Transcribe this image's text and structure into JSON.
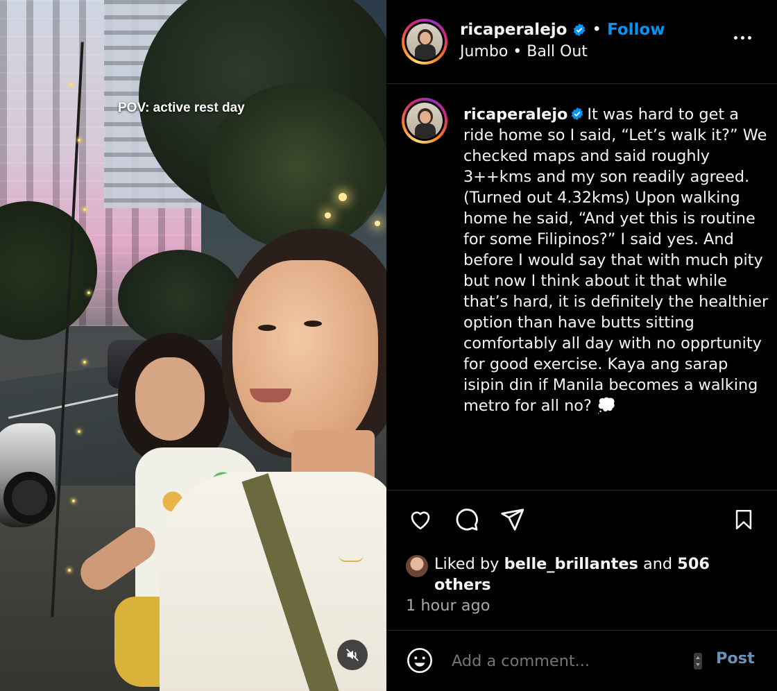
{
  "media": {
    "overlay_text": "POV: active rest day",
    "mute_icon": "muted-speaker-icon"
  },
  "header": {
    "username": "ricaperalejo",
    "separator": "•",
    "follow_label": "Follow",
    "audio": "Jumbo • Ball Out",
    "more_icon": "more-horizontal-icon"
  },
  "caption": {
    "username": "ricaperalejo",
    "text": "It was hard to get a ride home so I said, “Let’s walk it?” We checked maps and said roughly 3++kms and my son readily agreed. (Turned out 4.32kms) Upon walking home he said, “And yet this is routine for some Filipinos?” I said yes. And before I would say that with much pity but now I think about it that while that’s hard, it is definitely the healthier option than have butts sitting comfortably all day with no opprtunity for good exercise. Kaya ang sarap isipin din if Manila becomes a walking metro for all no? 💭"
  },
  "actions": {
    "like_icon": "heart-icon",
    "comment_icon": "comment-icon",
    "share_icon": "paper-plane-icon",
    "save_icon": "bookmark-icon"
  },
  "likes": {
    "prefix": "Liked by ",
    "user": "belle_brillantes",
    "middle": " and ",
    "count": "506",
    "suffix": "others"
  },
  "time": "1 hour ago",
  "comment": {
    "placeholder": "Add a comment...",
    "post_label": "Post",
    "emoji_icon": "smiley-icon"
  },
  "colors": {
    "accent": "#0095f6",
    "post_disabled": "#6b91b8",
    "background": "#000000",
    "text": "#f5f5f5",
    "muted": "#a8a8a8"
  }
}
